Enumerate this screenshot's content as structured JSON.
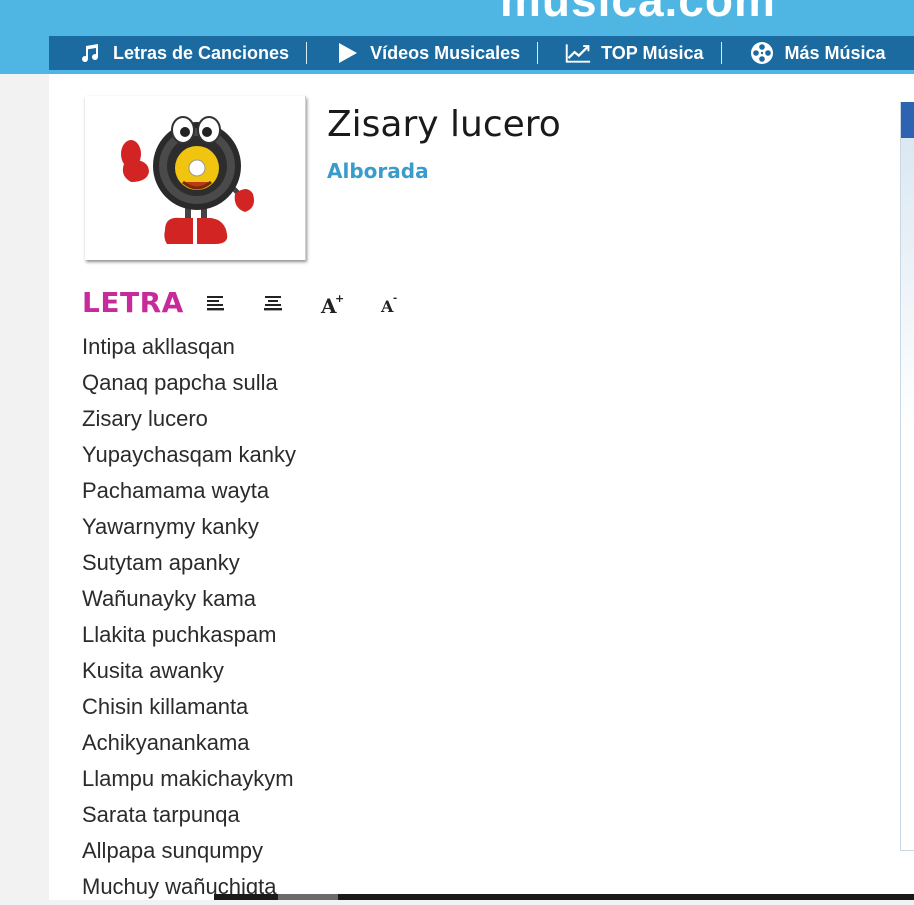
{
  "header": {
    "logo_text": "musica.com"
  },
  "nav": {
    "items": [
      {
        "label": "Letras de Canciones",
        "icon": "music-note-icon"
      },
      {
        "label": "Vídeos Musicales",
        "icon": "play-icon"
      },
      {
        "label": "TOP Música",
        "icon": "trend-chart-icon"
      },
      {
        "label": "Más Música",
        "icon": "film-reel-icon"
      }
    ]
  },
  "song": {
    "title": "Zisary lucero",
    "artist": "Alborada"
  },
  "lyrics_section": {
    "label": "LETRA",
    "tools": [
      "align-left-icon",
      "align-center-icon",
      "font-increase-icon",
      "font-decrease-icon"
    ],
    "lines": [
      "Intipa akllasqan",
      "Qanaq papcha sulla",
      "Zisary lucero",
      "Yupaychasqam kanky",
      "Pachamama wayta",
      "Yawarnymy kanky",
      "Sutytam apanky",
      "Wañunayky kama",
      "Llakita puchkaspam",
      "Kusita awanky",
      "Chisin killamanta",
      "Achikyanankama",
      "Llampu makichaykym",
      "Sarata tarpunqa",
      "Allpapa sunqumpy",
      "Muchuy wañuchiqta"
    ]
  },
  "colors": {
    "header_bg": "#4fb6e4",
    "nav_bg": "#1b6aa0",
    "artist_link": "#3a9ccb",
    "letra_label": "#c72a9b"
  }
}
